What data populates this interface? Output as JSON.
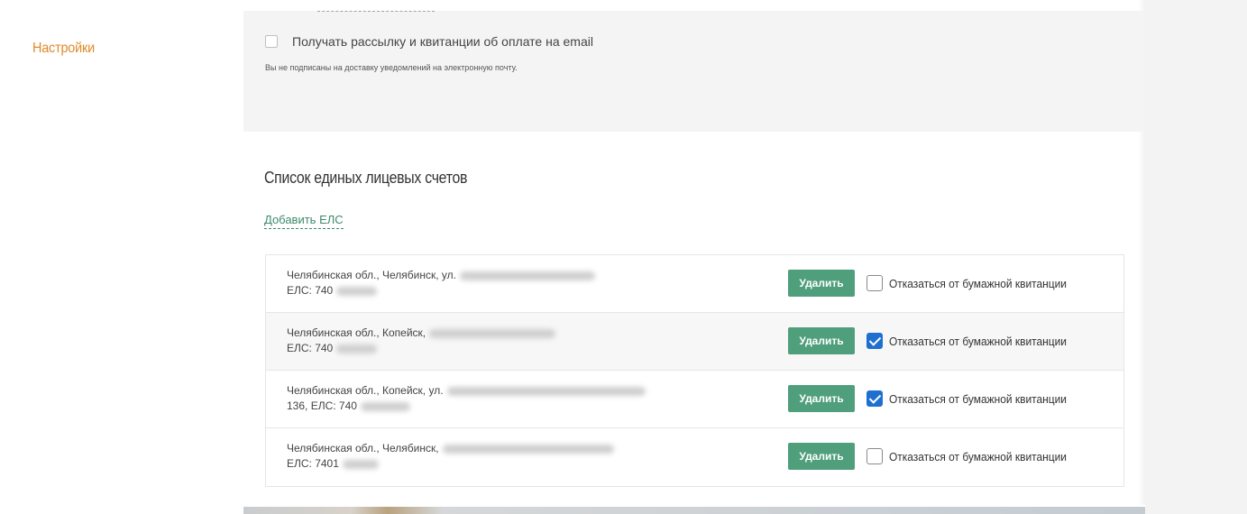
{
  "sidebar": {
    "settings_label": "Настройки"
  },
  "email_subscription": {
    "label": "Получать рассылку и квитанции об оплате на email",
    "checked": false,
    "note": "Вы не подписаны на доставку уведомлений на электронную почту."
  },
  "accounts_section": {
    "title": "Список единых лицевых счетов",
    "add_link": "Добавить ЕЛС",
    "delete_label": "Удалить",
    "paper_receipt_label": "Отказаться от бумажной квитанции",
    "rows": [
      {
        "address": "Челябинская обл., Челябинск, ул.",
        "els": "ЕЛС: 740",
        "paper_opt_out": false
      },
      {
        "address": "Челябинская обл., Копейск,",
        "els": "ЕЛС: 740",
        "paper_opt_out": true
      },
      {
        "address": "Челябинская обл., Копейск, ул.",
        "els": "136, ЕЛС: 740",
        "paper_opt_out": true
      },
      {
        "address": "Челябинская обл., Челябинск,",
        "els": "ЕЛС: 7401",
        "paper_opt_out": false
      }
    ]
  },
  "colors": {
    "accent_orange": "#e08a2b",
    "button_green": "#4f9e7c",
    "link_green": "#3c8a6c",
    "checkbox_blue": "#1e6fd0"
  }
}
